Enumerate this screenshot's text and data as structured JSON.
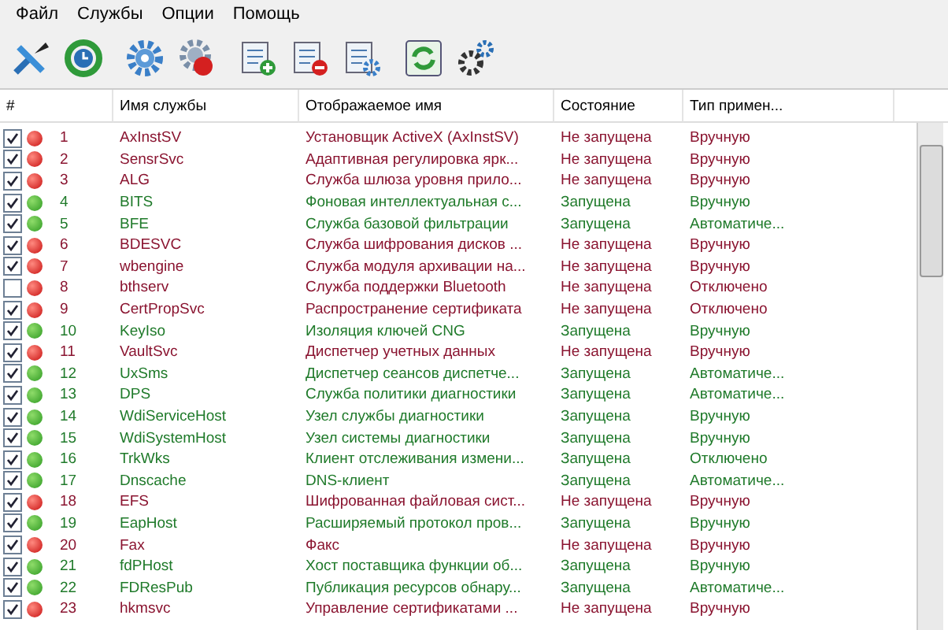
{
  "menu": [
    "Файл",
    "Службы",
    "Опции",
    "Помощь"
  ],
  "toolbar": [
    {
      "kind": "tools"
    },
    {
      "kind": "clock"
    },
    {
      "kind": "gear"
    },
    {
      "kind": "gear-stop"
    },
    {
      "kind": "list-add"
    },
    {
      "kind": "list-remove"
    },
    {
      "kind": "list-gear"
    },
    {
      "kind": "refresh"
    },
    {
      "kind": "gears"
    }
  ],
  "columns": [
    "#",
    "Имя службы",
    "Отображаемое имя",
    "Состояние",
    "Тип примен..."
  ],
  "rows": [
    {
      "checked": true,
      "running": false,
      "number": "1",
      "name": "AxInstSV",
      "display": "Установщик ActiveX (AxInstSV)",
      "state": "Не запущена",
      "start": "Вручную"
    },
    {
      "checked": true,
      "running": false,
      "number": "2",
      "name": "SensrSvc",
      "display": "Адаптивная регулировка ярк...",
      "state": "Не запущена",
      "start": "Вручную"
    },
    {
      "checked": true,
      "running": false,
      "number": "3",
      "name": "ALG",
      "display": "Служба шлюза уровня прило...",
      "state": "Не запущена",
      "start": "Вручную"
    },
    {
      "checked": true,
      "running": true,
      "number": "4",
      "name": "BITS",
      "display": "Фоновая интеллектуальная с...",
      "state": "Запущена",
      "start": "Вручную"
    },
    {
      "checked": true,
      "running": true,
      "number": "5",
      "name": "BFE",
      "display": "Служба базовой фильтрации",
      "state": "Запущена",
      "start": "Автоматиче..."
    },
    {
      "checked": true,
      "running": false,
      "number": "6",
      "name": "BDESVC",
      "display": "Служба шифрования дисков ...",
      "state": "Не запущена",
      "start": "Вручную"
    },
    {
      "checked": true,
      "running": false,
      "number": "7",
      "name": "wbengine",
      "display": "Служба модуля архивации на...",
      "state": "Не запущена",
      "start": "Вручную"
    },
    {
      "checked": false,
      "running": false,
      "number": "8",
      "name": "bthserv",
      "display": "Служба поддержки Bluetooth",
      "state": "Не запущена",
      "start": "Отключено"
    },
    {
      "checked": true,
      "running": false,
      "number": "9",
      "name": "CertPropSvc",
      "display": "Распространение сертификата",
      "state": "Не запущена",
      "start": "Отключено"
    },
    {
      "checked": true,
      "running": true,
      "number": "10",
      "name": "KeyIso",
      "display": "Изоляция ключей CNG",
      "state": "Запущена",
      "start": "Вручную"
    },
    {
      "checked": true,
      "running": false,
      "number": "11",
      "name": "VaultSvc",
      "display": "Диспетчер учетных данных",
      "state": "Не запущена",
      "start": "Вручную"
    },
    {
      "checked": true,
      "running": true,
      "number": "12",
      "name": "UxSms",
      "display": "Диспетчер сеансов диспетче...",
      "state": "Запущена",
      "start": "Автоматиче..."
    },
    {
      "checked": true,
      "running": true,
      "number": "13",
      "name": "DPS",
      "display": "Служба политики диагностики",
      "state": "Запущена",
      "start": "Автоматиче..."
    },
    {
      "checked": true,
      "running": true,
      "number": "14",
      "name": "WdiServiceHost",
      "display": "Узел службы диагностики",
      "state": "Запущена",
      "start": "Вручную"
    },
    {
      "checked": true,
      "running": true,
      "number": "15",
      "name": "WdiSystemHost",
      "display": "Узел системы диагностики",
      "state": "Запущена",
      "start": "Вручную"
    },
    {
      "checked": true,
      "running": true,
      "number": "16",
      "name": "TrkWks",
      "display": "Клиент отслеживания измени...",
      "state": "Запущена",
      "start": "Отключено"
    },
    {
      "checked": true,
      "running": true,
      "number": "17",
      "name": "Dnscache",
      "display": "DNS-клиент",
      "state": "Запущена",
      "start": "Автоматиче..."
    },
    {
      "checked": true,
      "running": false,
      "number": "18",
      "name": "EFS",
      "display": "Шифрованная файловая сист...",
      "state": "Не запущена",
      "start": "Вручную"
    },
    {
      "checked": true,
      "running": true,
      "number": "19",
      "name": "EapHost",
      "display": "Расширяемый протокол пров...",
      "state": "Запущена",
      "start": "Вручную"
    },
    {
      "checked": true,
      "running": false,
      "number": "20",
      "name": "Fax",
      "display": "Факс",
      "state": "Не запущена",
      "start": "Вручную"
    },
    {
      "checked": true,
      "running": true,
      "number": "21",
      "name": "fdPHost",
      "display": "Хост поставщика функции об...",
      "state": "Запущена",
      "start": "Вручную"
    },
    {
      "checked": true,
      "running": true,
      "number": "22",
      "name": "FDResPub",
      "display": "Публикация ресурсов обнару...",
      "state": "Запущена",
      "start": "Автоматиче..."
    },
    {
      "checked": true,
      "running": false,
      "number": "23",
      "name": "hkmsvc",
      "display": "Управление сертификатами ...",
      "state": "Не запущена",
      "start": "Вручную"
    }
  ]
}
